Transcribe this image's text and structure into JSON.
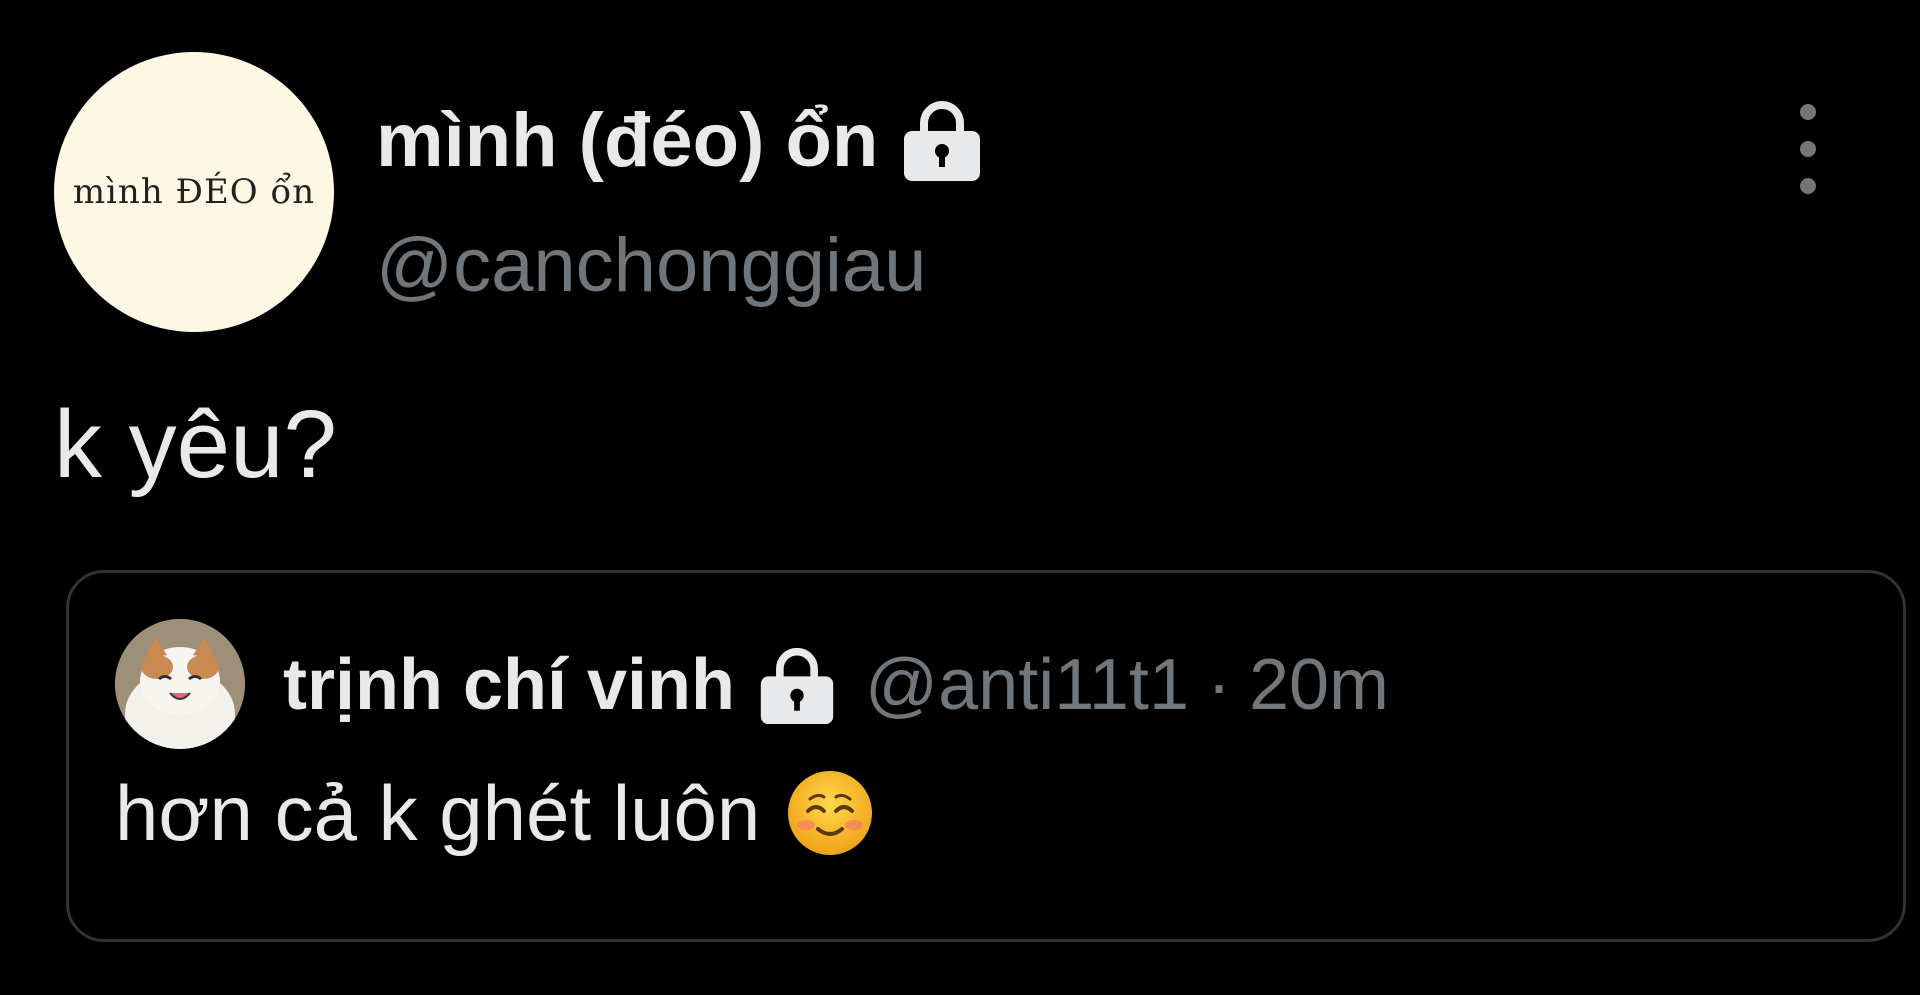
{
  "author": {
    "avatar_text": "mình ĐÉO ổn",
    "display_name": "mình (đéo) ổn",
    "handle": "@canchonggiau",
    "lock_icon": "lock-icon"
  },
  "more_icon": "more-vertical-icon",
  "tweet": {
    "text": "k yêu?"
  },
  "quote": {
    "display_name": "trịnh chí vinh",
    "lock_icon": "lock-icon",
    "handle": "@anti11t1",
    "separator": "·",
    "time": "20m",
    "text": "hơn cả k ghét luôn",
    "emoji_icon": "smiling-face-icon"
  },
  "colors": {
    "background": "#000000",
    "primary_text": "#e7e9ea",
    "secondary_text": "#71767b",
    "border": "#2f3336",
    "avatar_background": "#fdf8e4"
  }
}
